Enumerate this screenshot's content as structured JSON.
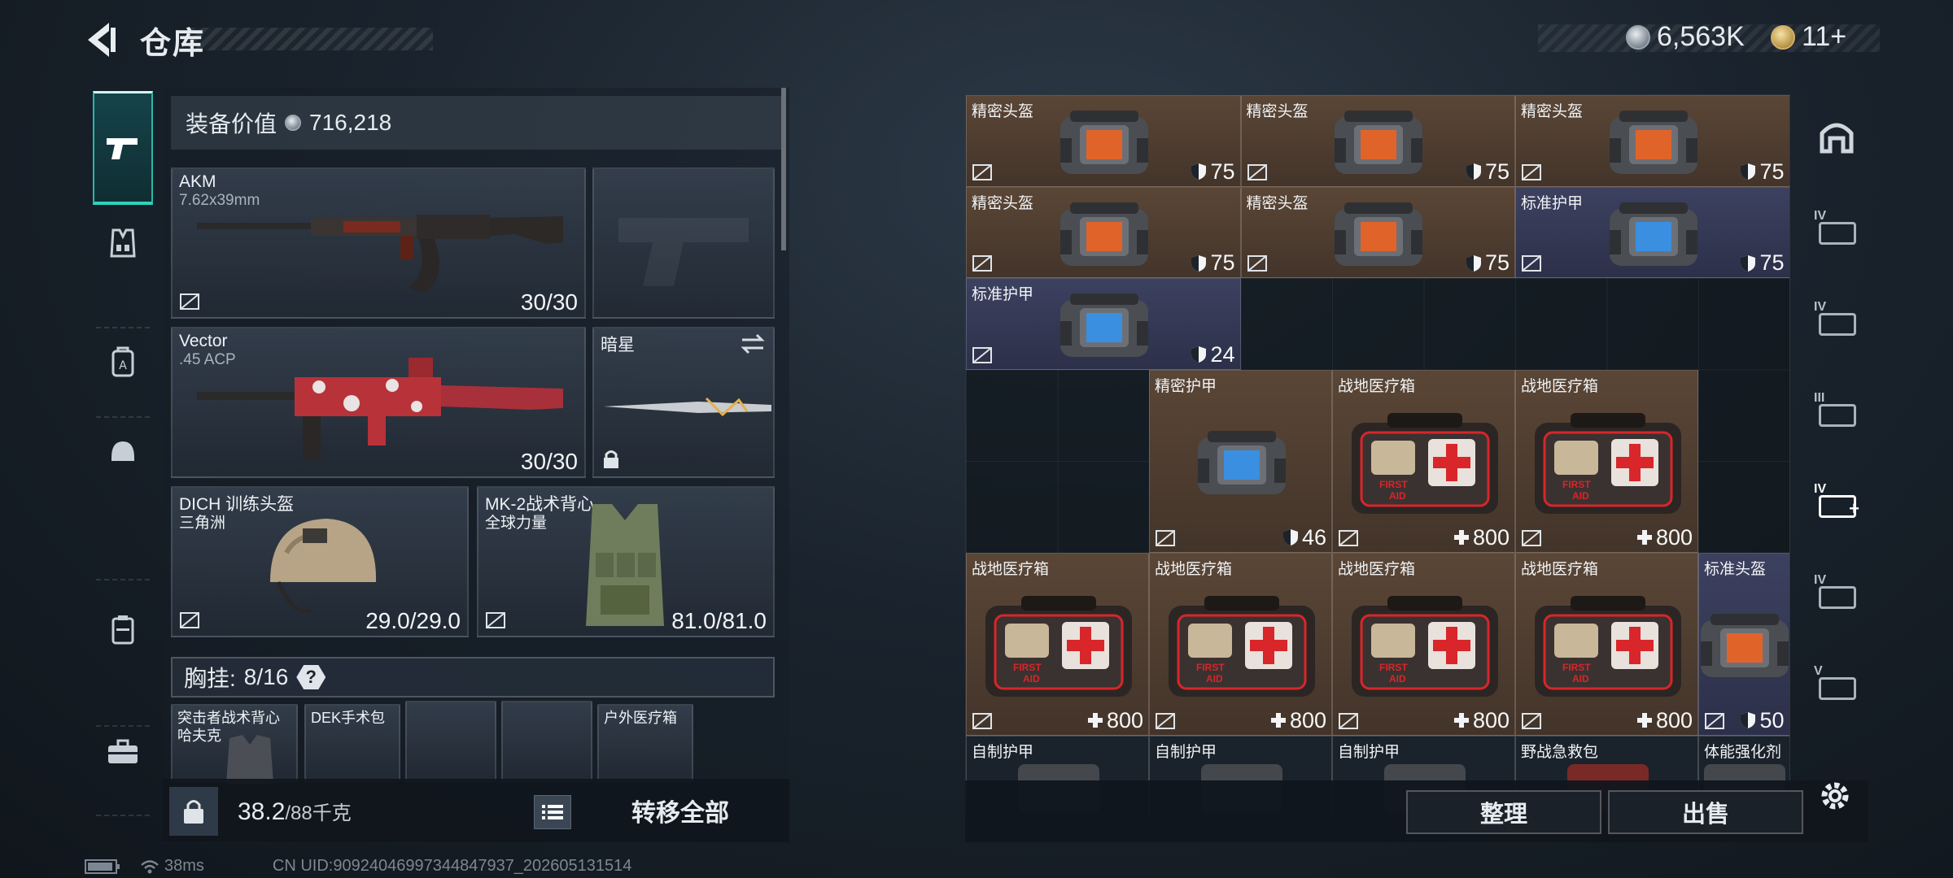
{
  "header": {
    "title": "仓库",
    "currency_primary": "6,563K",
    "currency_secondary": "11+"
  },
  "loadout": {
    "value_label": "装备价值",
    "value": "716,218",
    "weapons": [
      {
        "name": "AKM",
        "ammo_type": "7.62x39mm",
        "count": "30/30"
      },
      {
        "name": "Vector",
        "ammo_type": ".45 ACP",
        "count": "30/30"
      }
    ],
    "melee": {
      "name": "暗星"
    },
    "helmet": {
      "name": "DICH 训练头盔",
      "faction": "三角洲",
      "durability": "29.0/29.0"
    },
    "armor": {
      "name": "MK-2战术背心",
      "faction": "全球力量",
      "durability": "81.0/81.0"
    },
    "chest_rig": {
      "label": "胸挂:",
      "capacity": "8/16",
      "help": "?"
    },
    "rig_items": [
      {
        "name": "突击者战术背心 哈夫克"
      },
      {
        "name": "DEK手术包"
      },
      {
        "name": ""
      },
      {
        "name": ""
      },
      {
        "name": "户外医疗箱"
      }
    ],
    "weight": "38.2",
    "weight_max": "/88千克",
    "transfer_all": "转移全部"
  },
  "stash": {
    "items": [
      {
        "name": "精密头盔",
        "value": "75",
        "kind": "armor",
        "tint": "brown",
        "screen": "orange"
      },
      {
        "name": "精密头盔",
        "value": "75",
        "kind": "armor",
        "tint": "brown",
        "screen": "orange"
      },
      {
        "name": "精密头盔",
        "value": "75",
        "kind": "armor",
        "tint": "brown",
        "screen": "orange"
      },
      {
        "name": "精密头盔",
        "value": "75",
        "kind": "armor",
        "tint": "brown",
        "screen": "orange"
      },
      {
        "name": "精密头盔",
        "value": "75",
        "kind": "armor",
        "tint": "brown",
        "screen": "orange"
      },
      {
        "name": "标准护甲",
        "value": "75",
        "kind": "armor",
        "tint": "blue",
        "screen": "blue"
      },
      {
        "name": "标准护甲",
        "value": "24",
        "kind": "armor",
        "tint": "blue",
        "screen": "blue"
      },
      {
        "name": "精密护甲",
        "value": "46",
        "kind": "armor",
        "tint": "brown",
        "screen": "blue"
      },
      {
        "name": "战地医疗箱",
        "value": "800",
        "kind": "medkit",
        "tint": "brown"
      },
      {
        "name": "战地医疗箱",
        "value": "800",
        "kind": "medkit",
        "tint": "brown"
      },
      {
        "name": "战地医疗箱",
        "value": "800",
        "kind": "medkit",
        "tint": "brown"
      },
      {
        "name": "战地医疗箱",
        "value": "800",
        "kind": "medkit",
        "tint": "brown"
      },
      {
        "name": "战地医疗箱",
        "value": "800",
        "kind": "medkit",
        "tint": "brown"
      },
      {
        "name": "战地医疗箱",
        "value": "800",
        "kind": "medkit",
        "tint": "brown"
      },
      {
        "name": "标准头盔",
        "value": "50",
        "kind": "armor",
        "tint": "blue",
        "screen": "orange"
      },
      {
        "name": "自制护甲",
        "value": "",
        "kind": "partial",
        "tint": "dark"
      },
      {
        "name": "自制护甲",
        "value": "",
        "kind": "partial",
        "tint": "dark"
      },
      {
        "name": "自制护甲",
        "value": "",
        "kind": "partial",
        "tint": "dark"
      },
      {
        "name": "野战急救包",
        "value": "",
        "kind": "partial",
        "tint": "dark"
      },
      {
        "name": "体能强化剂",
        "value": "",
        "kind": "partial",
        "tint": "dark"
      }
    ],
    "first_aid_text_1": "FIRST",
    "first_aid_text_2": "AID",
    "organize": "整理",
    "sell": "出售"
  },
  "right_tabs": [
    "",
    "IV",
    "IV",
    "III",
    "IV",
    "IV",
    "V"
  ],
  "status": {
    "ping": "38ms",
    "uid": "CN UID:909240469973448479​37_202605131514"
  }
}
